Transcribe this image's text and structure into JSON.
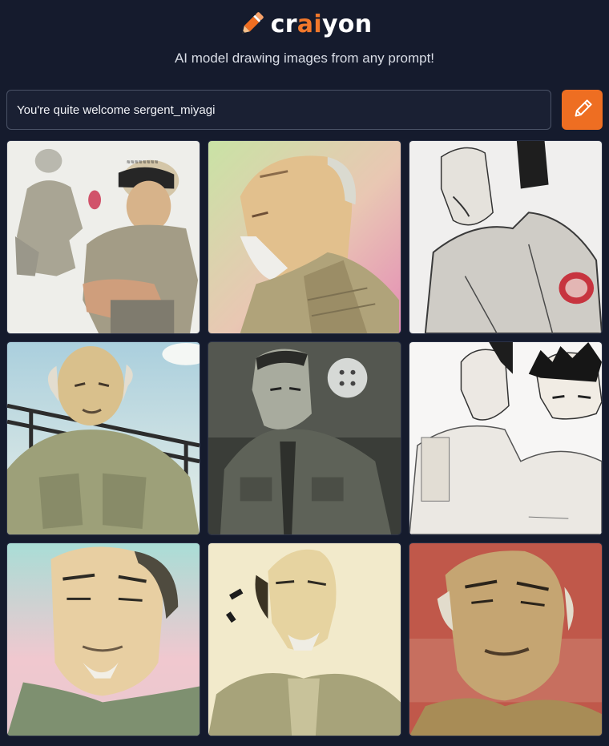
{
  "brand": {
    "name_parts": [
      "cr",
      "ai",
      "yon"
    ],
    "accent_color": "#f1782b",
    "logo_icon": "pencil-icon"
  },
  "tagline": "AI model drawing images from any prompt!",
  "prompt": {
    "value": "You're quite welcome sergent_miyagi",
    "draw_icon": "pencil-icon",
    "button_color": "#ee6e22"
  },
  "results": {
    "count": 9
  }
}
